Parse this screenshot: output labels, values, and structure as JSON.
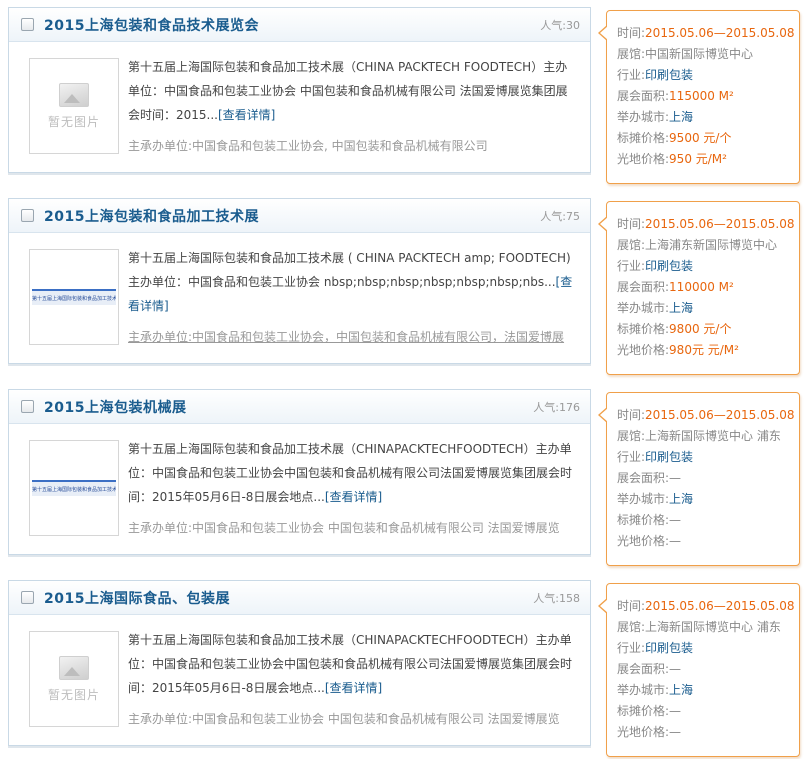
{
  "labels": {
    "popularity_prefix": "人气:",
    "time": "时间:",
    "venue": "展馆:",
    "industry": "行业:",
    "area": "展会面积:",
    "city": "举办城市:",
    "booth_price": "标摊价格:",
    "raw_price": "光地价格:",
    "detail_link": "[查看详情]",
    "no_image": "暂无图片"
  },
  "listings": [
    {
      "title": "2015上海包装和食品技术展览会",
      "popularity": "30",
      "thumb": "none",
      "description": "第十五届上海国际包装和食品加工技术展（CHINA PACKTECH FOODTECH）主办单位：中国食品和包装工业协会 中国包装和食品机械有限公司 法国爱博展览集团展会时间：2015...",
      "organizers": "主承办单位:中国食品和包装工业协会, 中国包装和食品机械有限公司",
      "organizers_underlined": false,
      "info": {
        "time": "2015.05.06—2015.05.08",
        "venue": "中国新国际博览中心",
        "industry": "印刷包装",
        "area": "115000 M²",
        "city": "上海",
        "booth_price": "9500 元/个",
        "raw_price": "950 元/M²"
      }
    },
    {
      "title": "2015上海包装和食品加工技术展",
      "popularity": "75",
      "thumb": "banner",
      "banner_text": "第十五届上海国际包装和食品加工技术展",
      "description": "第十五届上海国际包装和食品加工技术展 ( CHINA PACKTECH amp; FOODTECH) 主办单位：中国食品和包装工业协会 nbsp;nbsp;nbsp;nbsp;nbsp;nbsp;nbs...",
      "organizers": "主承办单位:中国食品和包装工业协会，中国包装和食品机械有限公司，法国爱博展",
      "organizers_underlined": true,
      "info": {
        "time": "2015.05.06—2015.05.08",
        "venue": "上海浦东新国际博览中心",
        "industry": "印刷包装",
        "area": "110000 M²",
        "city": "上海",
        "booth_price": "9800 元/个",
        "raw_price": "980元 元/M²"
      }
    },
    {
      "title": "2015上海包装机械展",
      "popularity": "176",
      "thumb": "banner",
      "banner_text": "第十五届上海国际包装和食品加工技术展",
      "description": "第十五届上海国际包装和食品加工技术展（CHINAPACKTECHFOODTECH）主办单位：中国食品和包装工业协会中国包装和食品机械有限公司法国爱博展览集团展会时间：2015年05月6日-8日展会地点...",
      "organizers": "主承办单位:中国食品和包装工业协会 中国包装和食品机械有限公司 法国爱博展览",
      "organizers_underlined": false,
      "info": {
        "time": "2015.05.06—2015.05.08",
        "venue": "上海新国际博览中心 浦东",
        "industry": "印刷包装",
        "area": "—",
        "city": "上海",
        "booth_price": "—",
        "raw_price": "—"
      }
    },
    {
      "title": "2015上海国际食品、包装展",
      "popularity": "158",
      "thumb": "none",
      "description": "第十五届上海国际包装和食品加工技术展（CHINAPACKTECHFOODTECH）主办单位：中国食品和包装工业协会中国包装和食品机械有限公司法国爱博展览集团展会时间：2015年05月6日-8日展会地点...",
      "organizers": "主承办单位:中国食品和包装工业协会 中国包装和食品机械有限公司 法国爱博展览",
      "organizers_underlined": false,
      "info": {
        "time": "2015.05.06—2015.05.08",
        "venue": "上海新国际博览中心 浦东",
        "industry": "印刷包装",
        "area": "—",
        "city": "上海",
        "booth_price": "—",
        "raw_price": "—"
      }
    }
  ],
  "colors": {
    "title": "#1a5c8e",
    "accent_orange": "#e8660e",
    "info_border": "#f0a04a",
    "card_border": "#c9d9e6"
  }
}
